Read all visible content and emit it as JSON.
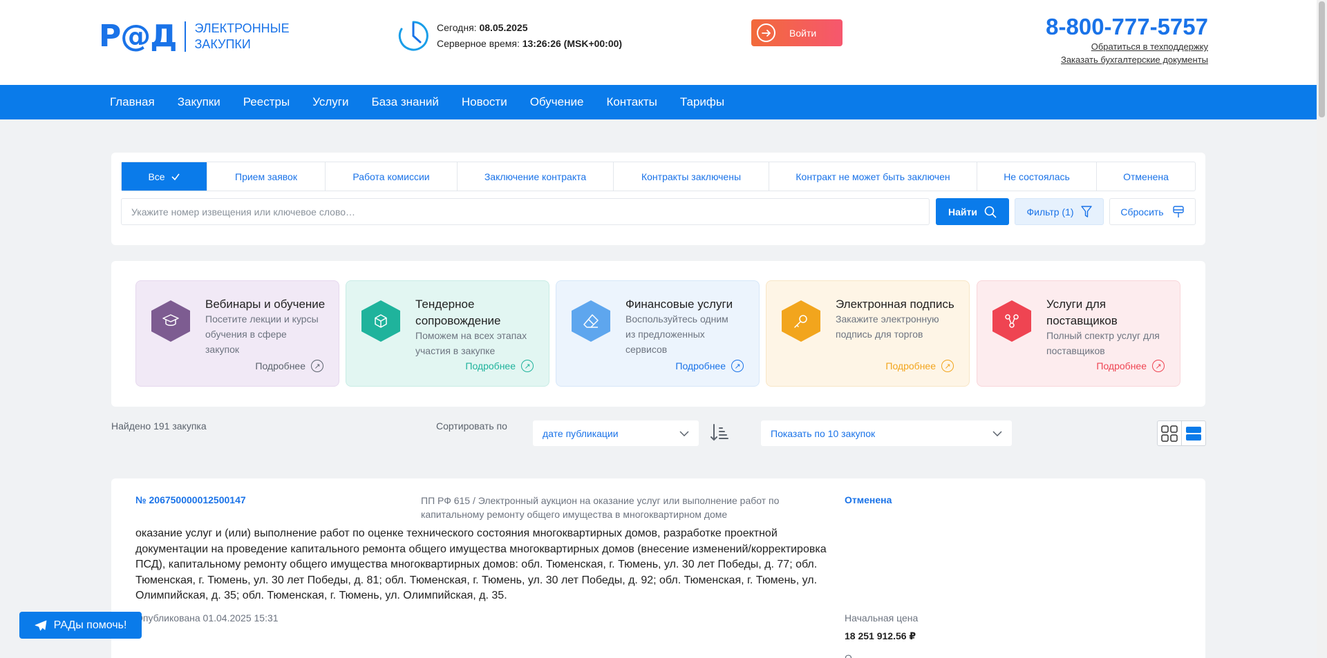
{
  "header": {
    "logo_mark": "Р@Д",
    "logo_line1": "ЭЛЕКТРОННЫЕ",
    "logo_line2": "ЗАКУПКИ",
    "today_label": "Сегодня:",
    "today_value": "08.05.2025",
    "server_time_label": "Серверное время:",
    "server_time_value": "13:26:26 (MSK+00:00)",
    "login_label": "Войти",
    "phone": "8-800-777-5757",
    "support_link": "Обратиться в техподдержку",
    "docs_link": "Заказать бухгалтерские документы"
  },
  "nav": {
    "items": [
      "Главная",
      "Закупки",
      "Реестры",
      "Услуги",
      "База знаний",
      "Новости",
      "Обучение",
      "Контакты",
      "Тарифы"
    ]
  },
  "filters": {
    "tabs": [
      "Все",
      "Прием заявок",
      "Работа комиссии",
      "Заключение контракта",
      "Контракты заключены",
      "Контракт не может быть заключен",
      "Не состоялась",
      "Отменена"
    ],
    "active_tab": "Все",
    "search_placeholder": "Укажите номер извещения или ключевое слово…",
    "search_value": "",
    "find_label": "Найти",
    "filter_label": "Фильтр (1)",
    "reset_label": "Сбросить"
  },
  "services": [
    {
      "title": "Вебинары и обучение",
      "desc": "Посетите лекции и курсы обучения в сфере закупок",
      "more": "Подробнее",
      "icon": "graduation-cap-icon",
      "color": "#7d5c91",
      "bg": "#f1e9f6",
      "border": "#e6d8ee",
      "more_color": "#5b636d"
    },
    {
      "title": "Тендерное сопровождение",
      "desc": "Поможем на всех этапах участия в закупке",
      "more": "Подробнее",
      "icon": "cubes-icon",
      "color": "#1fb39c",
      "bg": "#e2f6f2",
      "border": "#c8ece5",
      "more_color": "#1fb39c"
    },
    {
      "title": "Финансовые услуги",
      "desc": "Воспользуйтесь одним из предложенных сервисов",
      "more": "Подробнее",
      "icon": "eraser-icon",
      "color": "#5ea6ee",
      "bg": "#ecf4fd",
      "border": "#d6e7f9",
      "more_color": "#1a73e8"
    },
    {
      "title": "Электронная подпись",
      "desc": "Закажите электронную подпись для торгов",
      "more": "Подробнее",
      "icon": "key-icon",
      "color": "#f2a51d",
      "bg": "#fef5e6",
      "border": "#f8e6c6",
      "more_color": "#f2a51d"
    },
    {
      "title": "Услуги для поставщиков",
      "desc": "Полный спектр услуг для поставщиков",
      "more": "Подробнее",
      "icon": "share-nodes-icon",
      "color": "#ef4452",
      "bg": "#fdecee",
      "border": "#f9d6da",
      "more_color": "#ef4452"
    }
  ],
  "results": {
    "found": "Найдено 191 закупка",
    "sort_label": "Сортировать по",
    "sort_value": "дате публикации",
    "page_size_value": "Показать по 10 закупок"
  },
  "card": {
    "number": "№ 206750000012500147",
    "type": "ПП РФ 615 / Электронный аукцион на оказание услуг или выполнение работ по капитальному ремонту общего имущества в многоквартирном доме",
    "status": "Отменена",
    "description": "оказание услуг и (или) выполнение работ по оценке технического состояния многоквартирных домов, разработке проектной документации на проведение капитального ремонта общего имущества многоквартирных домов (внесение изменений/корректировка ПСД), капитальному ремонту общего имущества многоквартирных домов: обл. Тюменская, г. Тюмень, ул. 30 лет Победы, д. 77; обл. Тюменская, г. Тюмень, ул. 30 лет Победы, д. 81; обл. Тюменская, г. Тюмень, ул. 30 лет Победы, д. 92; обл. Тюменская, г. Тюмень, ул. Олимпийская, д. 35; обл. Тюменская, г. Тюмень, ул. Олимпийская, д. 35.",
    "published": "Опубликована 01.04.2025 15:31",
    "price_label": "Начальная цена",
    "price_value": "18 251 912.56 ₽",
    "trailing_label": "О"
  },
  "help_label": "РАДы помочь!",
  "colors": {
    "accent": "#0a7bea",
    "link": "#1a73e8",
    "login_from": "#f26a3a",
    "login_to": "#f6576e"
  }
}
